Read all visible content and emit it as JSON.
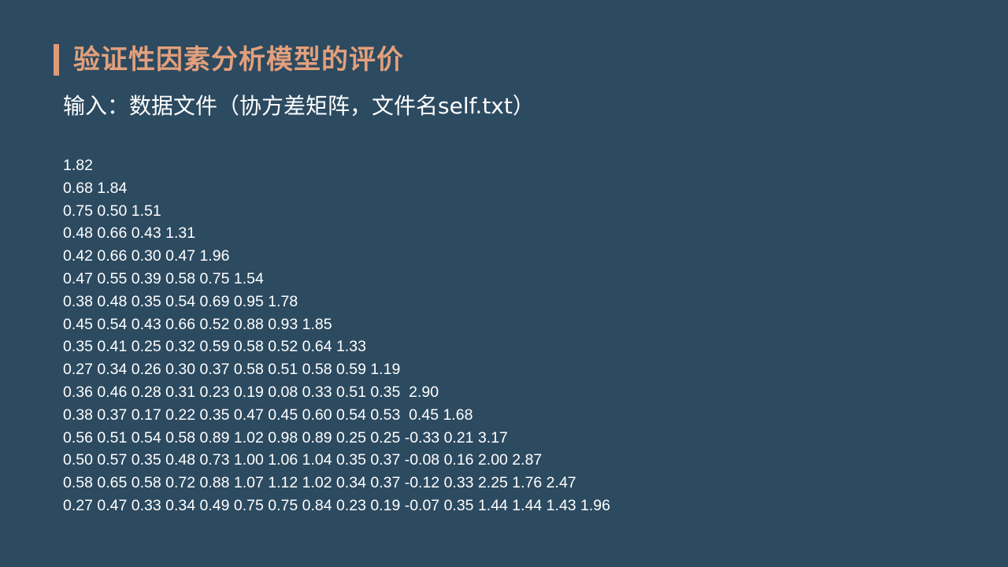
{
  "slide": {
    "title": "验证性因素分析模型的评价",
    "subtitle": "输入：数据文件（协方差矩阵，文件名self.txt）",
    "accent_color": "#e09a78",
    "background_color": "#2c4a60",
    "matrix_rows": [
      "1.82",
      "0.68 1.84",
      "0.75 0.50 1.51",
      "0.48 0.66 0.43 1.31",
      "0.42 0.66 0.30 0.47 1.96",
      "0.47 0.55 0.39 0.58 0.75 1.54",
      "0.38 0.48 0.35 0.54 0.69 0.95 1.78",
      "0.45 0.54 0.43 0.66 0.52 0.88 0.93 1.85",
      "0.35 0.41 0.25 0.32 0.59 0.58 0.52 0.64 1.33",
      "0.27 0.34 0.26 0.30 0.37 0.58 0.51 0.58 0.59 1.19",
      "0.36 0.46 0.28 0.31 0.23 0.19 0.08 0.33 0.51 0.35  2.90",
      "0.38 0.37 0.17 0.22 0.35 0.47 0.45 0.60 0.54 0.53  0.45 1.68",
      "0.56 0.51 0.54 0.58 0.89 1.02 0.98 0.89 0.25 0.25 -0.33 0.21 3.17",
      "0.50 0.57 0.35 0.48 0.73 1.00 1.06 1.04 0.35 0.37 -0.08 0.16 2.00 2.87",
      "0.58 0.65 0.58 0.72 0.88 1.07 1.12 1.02 0.34 0.37 -0.12 0.33 2.25 1.76 2.47",
      "0.27 0.47 0.33 0.34 0.49 0.75 0.75 0.84 0.23 0.19 -0.07 0.35 1.44 1.44 1.43 1.96"
    ]
  }
}
